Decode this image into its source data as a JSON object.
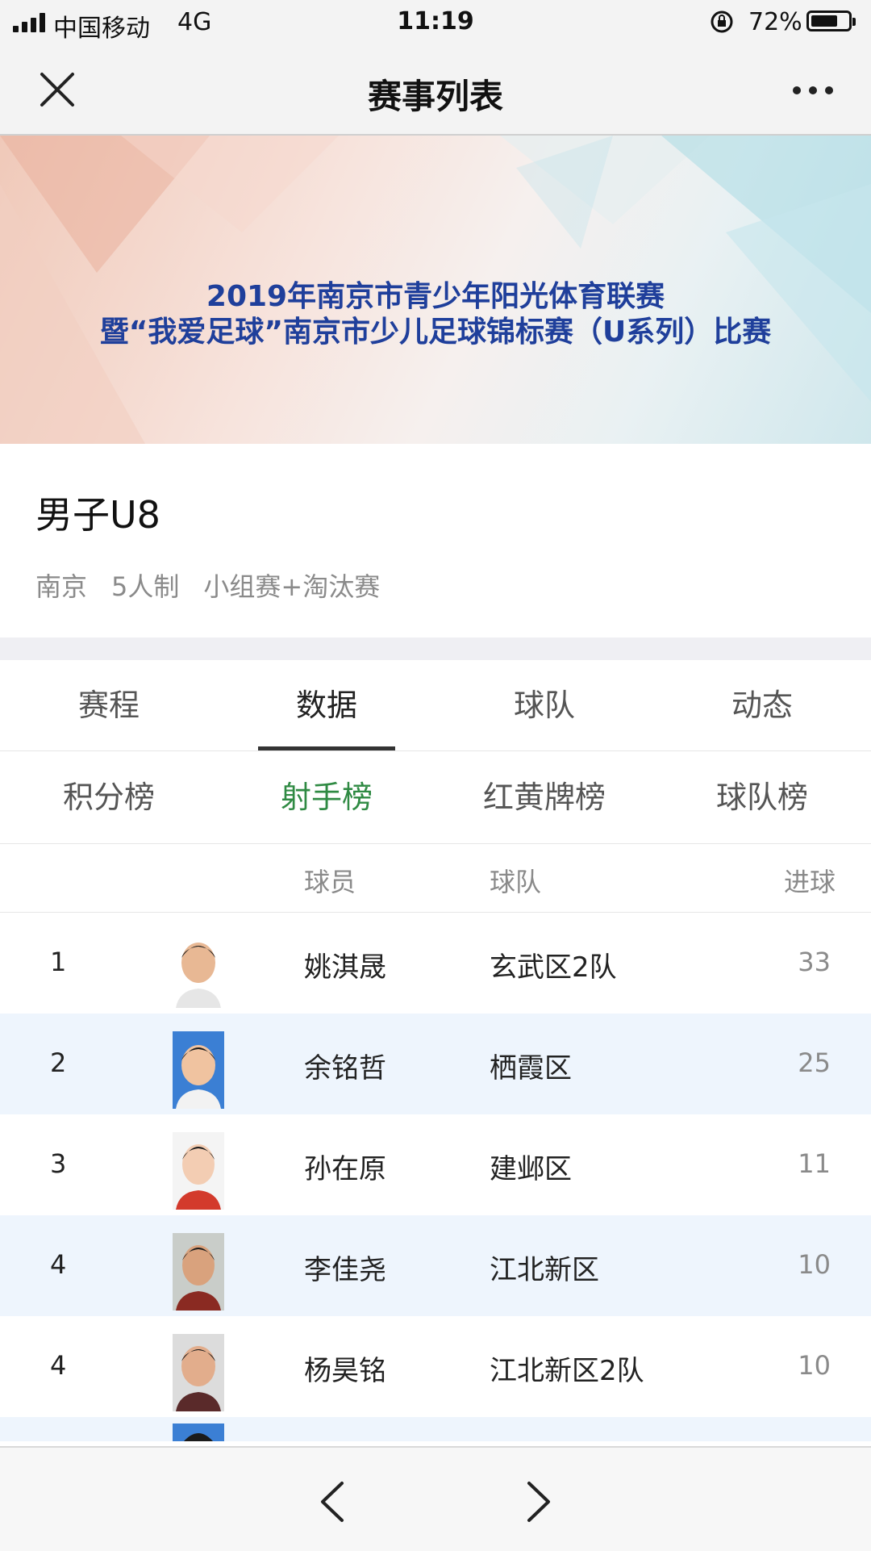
{
  "status": {
    "carrier": "中国移动",
    "network": "4G",
    "time": "11:19",
    "battery_text": "72%",
    "battery_level": 0.72
  },
  "nav": {
    "title": "赛事列表",
    "close_icon": "close-icon",
    "more_icon": "more-icon"
  },
  "banner": {
    "line1": "2019年南京市青少年阳光体育联赛",
    "line2": "暨“我爱足球”南京市少儿足球锦标赛（U系列）比赛"
  },
  "event": {
    "name": "男子U8",
    "city": "南京",
    "format": "5人制",
    "stage": "小组赛+淘汰赛"
  },
  "tabs": [
    "赛程",
    "数据",
    "球队",
    "动态"
  ],
  "active_tab": "数据",
  "subtabs": [
    "积分榜",
    "射手榜",
    "红黄牌榜",
    "球队榜"
  ],
  "active_subtab": "射手榜",
  "accent_color": "#2f8a43",
  "table": {
    "headers": {
      "player": "球员",
      "team": "球队",
      "goals": "进球"
    },
    "rows": [
      {
        "rank": "1",
        "player": "姚淇晟",
        "team": "玄武区2队",
        "goals": "33"
      },
      {
        "rank": "2",
        "player": "余铭哲",
        "team": "栖霞区",
        "goals": "25"
      },
      {
        "rank": "3",
        "player": "孙在原",
        "team": "建邺区",
        "goals": "11"
      },
      {
        "rank": "4",
        "player": "李佳尧",
        "team": "江北新区",
        "goals": "10"
      },
      {
        "rank": "4",
        "player": "杨昊铭",
        "team": "江北新区2队",
        "goals": "10"
      }
    ]
  },
  "bottom": {
    "back_icon": "chevron-left-icon",
    "forward_icon": "chevron-right-icon"
  }
}
